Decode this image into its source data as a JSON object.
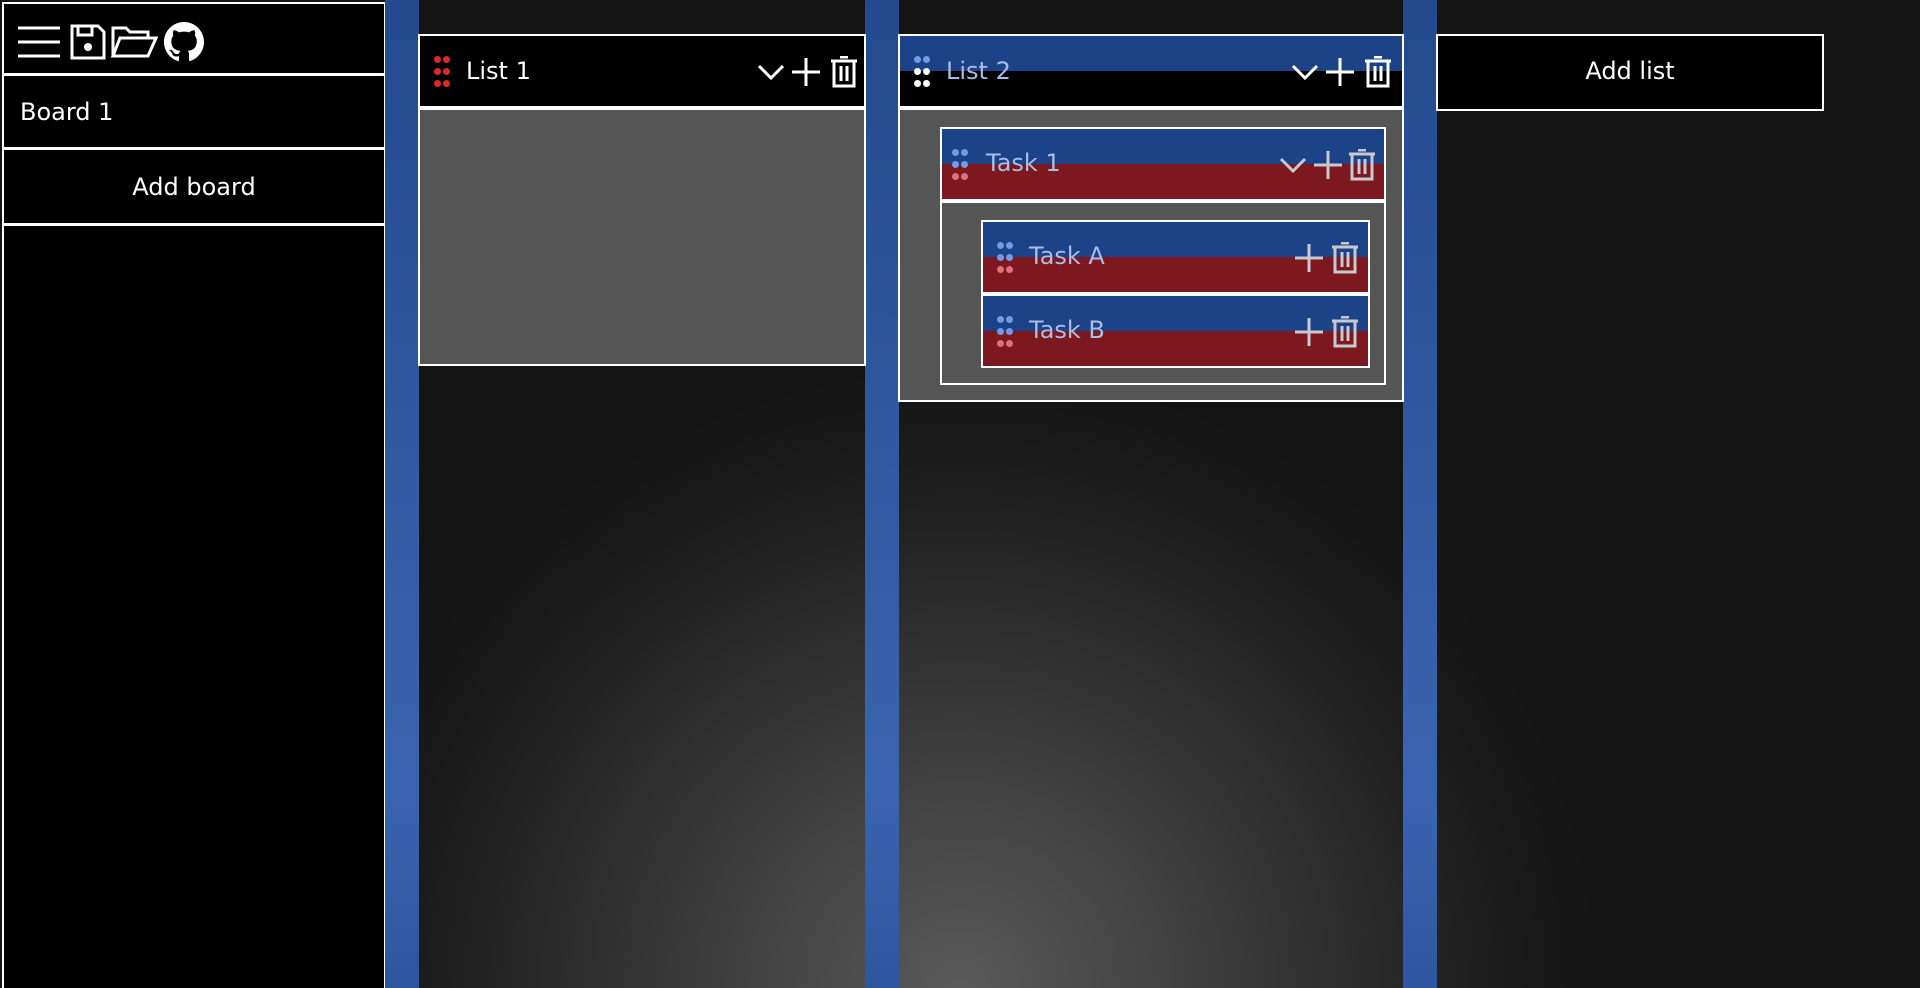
{
  "toolbar": {
    "icons": [
      "menu-icon",
      "save-icon",
      "folder-open-icon",
      "github-icon"
    ]
  },
  "sidebar": {
    "boards": [
      {
        "label": "Board 1"
      }
    ],
    "add_board_label": "Add board"
  },
  "lists": [
    {
      "title": "List 1",
      "tasks": []
    },
    {
      "title": "List 2",
      "tasks": [
        {
          "title": "Task 1",
          "subtasks": [
            {
              "title": "Task A"
            },
            {
              "title": "Task B"
            }
          ]
        }
      ]
    }
  ],
  "add_list_label": "Add list",
  "colors": {
    "drop_zone_blue": "#2a559f",
    "task_red": "#7c181e",
    "task_blue": "#1c4288",
    "drag_handle_red": "#e0262e"
  }
}
